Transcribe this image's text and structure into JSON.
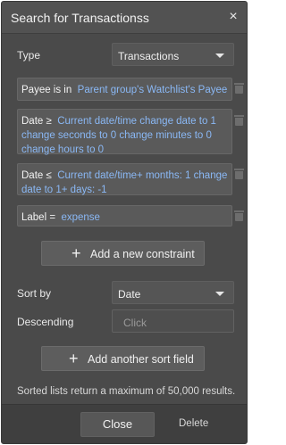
{
  "window": {
    "title": "Search for Transactionss",
    "close_glyph": "×"
  },
  "type_field": {
    "label": "Type",
    "value": "Transactions"
  },
  "constraints": [
    {
      "lhs": "Payee is in",
      "rhs": "Parent group's Watchlist's Payee"
    },
    {
      "lhs": "Date ≥",
      "rhs": "Current date/time change date to 1 change seconds to 0 change minutes to 0 change hours to 0"
    },
    {
      "lhs": "Date ≤",
      "rhs": "Current date/time+ months: 1 change date to 1+ days: -1"
    },
    {
      "lhs": "Label =",
      "rhs": "expense"
    }
  ],
  "add_constraint_label": "Add a new constraint",
  "sort_by": {
    "label": "Sort by",
    "value": "Date"
  },
  "descending": {
    "label": "Descending",
    "placeholder": "Click"
  },
  "add_sort_label": "Add another sort field",
  "footnote": "Sorted lists return a maximum of 50,000 results.",
  "footer": {
    "close_label": "Close",
    "delete_label": "Delete"
  },
  "icons": {
    "plus": "+",
    "trash": "trash-icon",
    "caret": "chevron-down-icon",
    "close": "close-icon"
  }
}
